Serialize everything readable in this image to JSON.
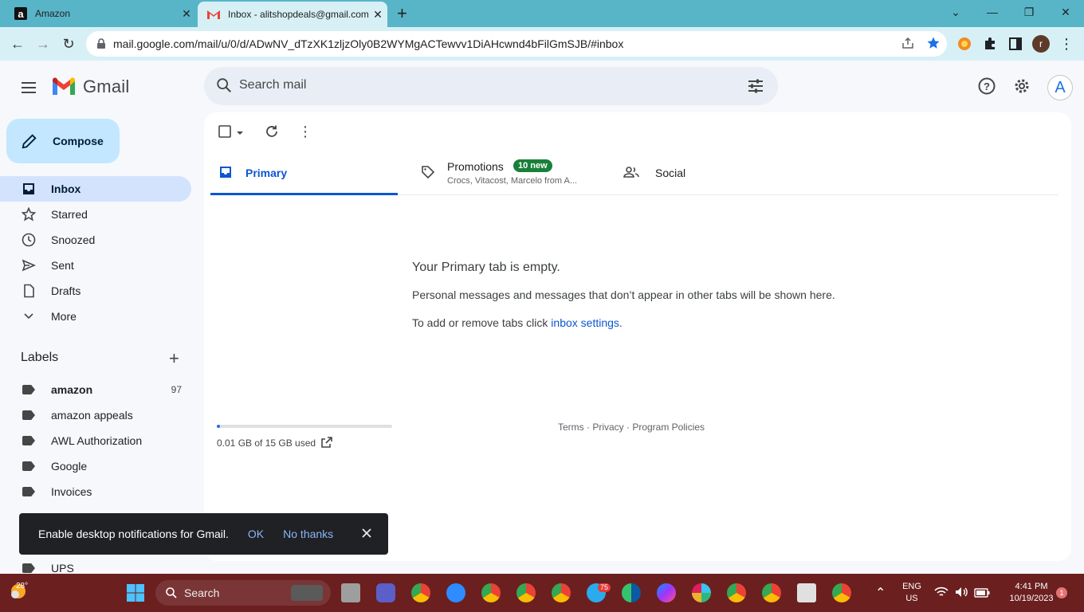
{
  "browser": {
    "tabs": [
      {
        "title": "Amazon",
        "favicon": "a"
      },
      {
        "title": "Inbox - alitshopdeals@gmail.com"
      }
    ],
    "url": "mail.google.com/mail/u/0/d/ADwNV_dTzXK1zljzOly0B2WYMgACTewvv1DiAHcwnd4bFilGmSJB/#inbox",
    "profile_initial": "r"
  },
  "gmail": {
    "logo_text": "Gmail",
    "search_placeholder": "Search mail",
    "account_initial": "A"
  },
  "sidebar": {
    "compose_label": "Compose",
    "items": [
      {
        "label": "Inbox"
      },
      {
        "label": "Starred"
      },
      {
        "label": "Snoozed"
      },
      {
        "label": "Sent"
      },
      {
        "label": "Drafts"
      },
      {
        "label": "More"
      }
    ],
    "labels_heading": "Labels",
    "labels": [
      {
        "label": "amazon",
        "count": "97"
      },
      {
        "label": "amazon appeals"
      },
      {
        "label": "AWL Authorization"
      },
      {
        "label": "Google"
      },
      {
        "label": "Invoices"
      },
      {
        "label": "UPS"
      }
    ]
  },
  "main": {
    "tabs": {
      "primary": "Primary",
      "promotions": "Promotions",
      "promotions_badge": "10 new",
      "promotions_sub": "Crocs, Vitacost, Marcelo from A...",
      "social": "Social"
    },
    "empty_title": "Your Primary tab is empty.",
    "empty_desc": "Personal messages and messages that don’t appear in other tabs will be shown here.",
    "empty_tabs_prefix": "To add or remove tabs click ",
    "empty_tabs_link": "inbox settings",
    "empty_tabs_suffix": ".",
    "storage_text": "0.01 GB of 15 GB used",
    "storage_fraction": 0.02,
    "footer": "Terms · Privacy · Program Policies"
  },
  "snackbar": {
    "message": "Enable desktop notifications for Gmail.",
    "ok": "OK",
    "no_thanks": "No thanks"
  },
  "taskbar": {
    "weather": "28°",
    "search_label": "Search",
    "telegram_badge": "75",
    "lang": "ENG",
    "region": "US",
    "time": "4:41 PM",
    "date": "10/19/2023",
    "notification_count": "1"
  },
  "colors": {
    "tabbar": "#58b5c8",
    "toolbar": "#d7f0f6",
    "compose": "#c2e7ff",
    "active_nav": "#d3e3fd",
    "primary_accent": "#0b57d0",
    "promo_badge": "#188038",
    "taskbar": "#6b1f1f"
  }
}
